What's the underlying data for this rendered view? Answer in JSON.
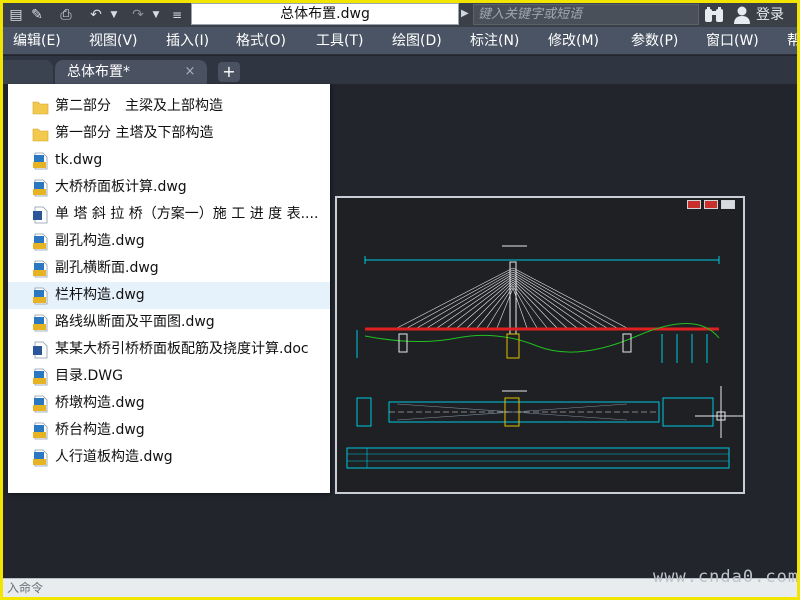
{
  "app": {
    "document_title": "总体布置.dwg",
    "search_placeholder": "键入关键字或短语",
    "login_label": "登录"
  },
  "menu": [
    {
      "label": "编辑(E)"
    },
    {
      "label": "视图(V)"
    },
    {
      "label": "插入(I)"
    },
    {
      "label": "格式(O)"
    },
    {
      "label": "工具(T)"
    },
    {
      "label": "绘图(D)"
    },
    {
      "label": "标注(N)"
    },
    {
      "label": "修改(M)"
    },
    {
      "label": "参数(P)"
    },
    {
      "label": "窗口(W)"
    },
    {
      "label": "帮"
    }
  ],
  "tabs": {
    "active_label": "总体布置*",
    "add_label": "+",
    "close_label": "×"
  },
  "file_list": [
    {
      "name": "第二部分　主梁及上部构造",
      "type": "folder"
    },
    {
      "name": "第一部分 主塔及下部构造",
      "type": "folder"
    },
    {
      "name": "tk.dwg",
      "type": "dwg"
    },
    {
      "name": "大桥桥面板计算.dwg",
      "type": "dwg"
    },
    {
      "name": "单 塔 斜 拉 桥（方案一）施 工 进 度 表....",
      "type": "doc"
    },
    {
      "name": "副孔构造.dwg",
      "type": "dwg"
    },
    {
      "name": "副孔横断面.dwg",
      "type": "dwg"
    },
    {
      "name": "栏杆构造.dwg",
      "type": "dwg",
      "highlighted": true
    },
    {
      "name": "路线纵断面及平面图.dwg",
      "type": "dwg"
    },
    {
      "name": "某某大桥引桥桥面板配筋及挠度计算.doc",
      "type": "doc"
    },
    {
      "name": "目录.DWG",
      "type": "dwg"
    },
    {
      "name": "桥墩构造.dwg",
      "type": "dwg"
    },
    {
      "name": "桥台构造.dwg",
      "type": "dwg"
    },
    {
      "name": "人行道板构造.dwg",
      "type": "dwg"
    }
  ],
  "status": {
    "command_hint": "入命令"
  },
  "watermark": "www.cnda0.com",
  "colors": {
    "frame": "#f2e600",
    "canvas": "#22252c",
    "menubar": "#4a5464",
    "highlight_row": "#e5f1fb"
  }
}
